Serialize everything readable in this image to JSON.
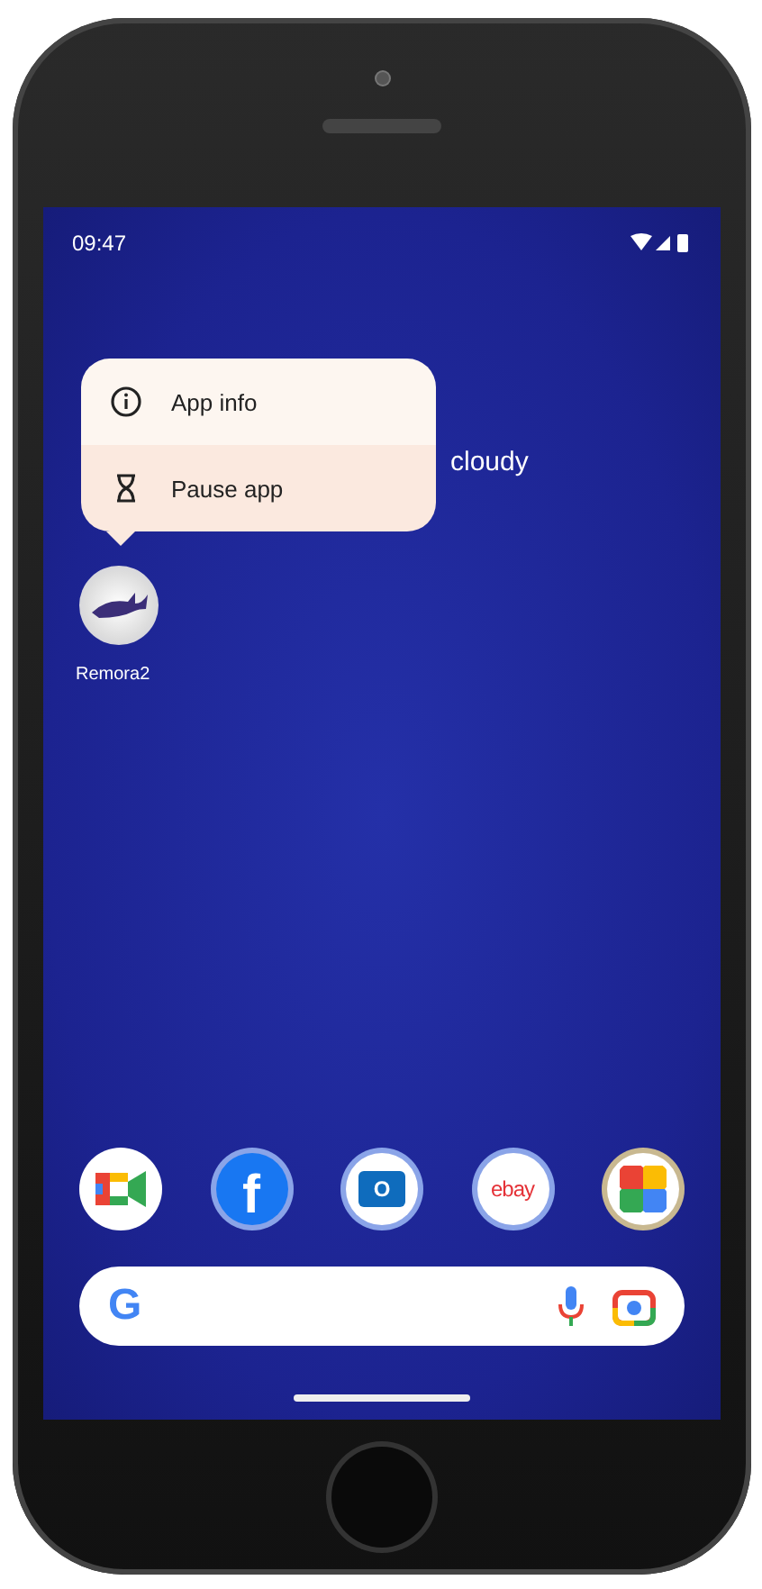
{
  "status_bar": {
    "time": "09:47"
  },
  "weather": {
    "text": "cloudy"
  },
  "context_menu": {
    "items": [
      {
        "kind": "info",
        "label": "App info"
      },
      {
        "kind": "pause",
        "label": "Pause app"
      }
    ]
  },
  "app": {
    "label": "Remora2"
  },
  "dock": [
    {
      "kind": "meet"
    },
    {
      "kind": "facebook",
      "text": "f"
    },
    {
      "kind": "outlook",
      "text": "O"
    },
    {
      "kind": "ebay",
      "text": "ebay"
    },
    {
      "kind": "photos"
    }
  ],
  "search_bar": {
    "logo": "G"
  }
}
